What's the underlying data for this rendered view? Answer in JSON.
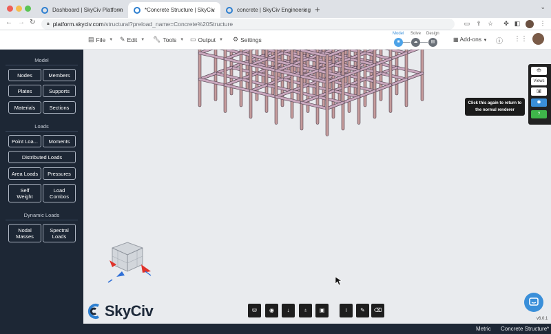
{
  "browser": {
    "tabs": [
      {
        "title": "Dashboard | SkyCiv Platform",
        "active": false
      },
      {
        "title": "*Concrete Structure | SkyCiv",
        "active": true
      },
      {
        "title": "concrete | SkyCiv Engineering",
        "active": false
      }
    ],
    "tab_close": "×",
    "new_tab": "+",
    "url_host": "platform.skyciv.com",
    "url_path": "/structural?preload_name=Concrete%20Structure"
  },
  "header": {
    "menus": [
      {
        "label": "File",
        "icon": "file-icon"
      },
      {
        "label": "Edit",
        "icon": "edit-icon"
      },
      {
        "label": "Tools",
        "icon": "wrench-icon"
      },
      {
        "label": "Output",
        "icon": "monitor-icon"
      },
      {
        "label": "Settings",
        "icon": "gear-icon"
      }
    ],
    "workflow": [
      {
        "label": "Model",
        "active": true
      },
      {
        "label": "Solve",
        "active": false
      },
      {
        "label": "Design",
        "active": false
      }
    ],
    "addons_label": "Add-ons"
  },
  "sidebar": {
    "model_title": "Model",
    "model_buttons": [
      "Nodes",
      "Members",
      "Plates",
      "Supports",
      "Materials",
      "Sections"
    ],
    "loads_title": "Loads",
    "loads_row1": [
      "Point Loa...",
      "Moments"
    ],
    "distributed_label": "Distributed Loads",
    "loads_row2": [
      "Area Loads",
      "Pressures"
    ],
    "self_weight": [
      "Self",
      "Weight"
    ],
    "load_combos": [
      "Load",
      "Combos"
    ],
    "dynamic_title": "Dynamic Loads",
    "nodal_masses": [
      "Nodal",
      "Masses"
    ],
    "spectral_loads": [
      "Spectral",
      "Loads"
    ]
  },
  "right_panel": {
    "views_label": "Views",
    "tooltip_line1": "Click this again to return to",
    "tooltip_line2": "the normal renderer"
  },
  "logo_text": "SkyCiv",
  "version": "v6.0.1",
  "status": {
    "units": "Metric",
    "project": "Concrete Structure*"
  },
  "colors": {
    "sidebar_bg": "#1d2735",
    "accent_blue": "#3a8fd9",
    "member_pink": "#c9a7bd",
    "column_rose": "#c59b9b",
    "help_green": "#3fb54a"
  }
}
